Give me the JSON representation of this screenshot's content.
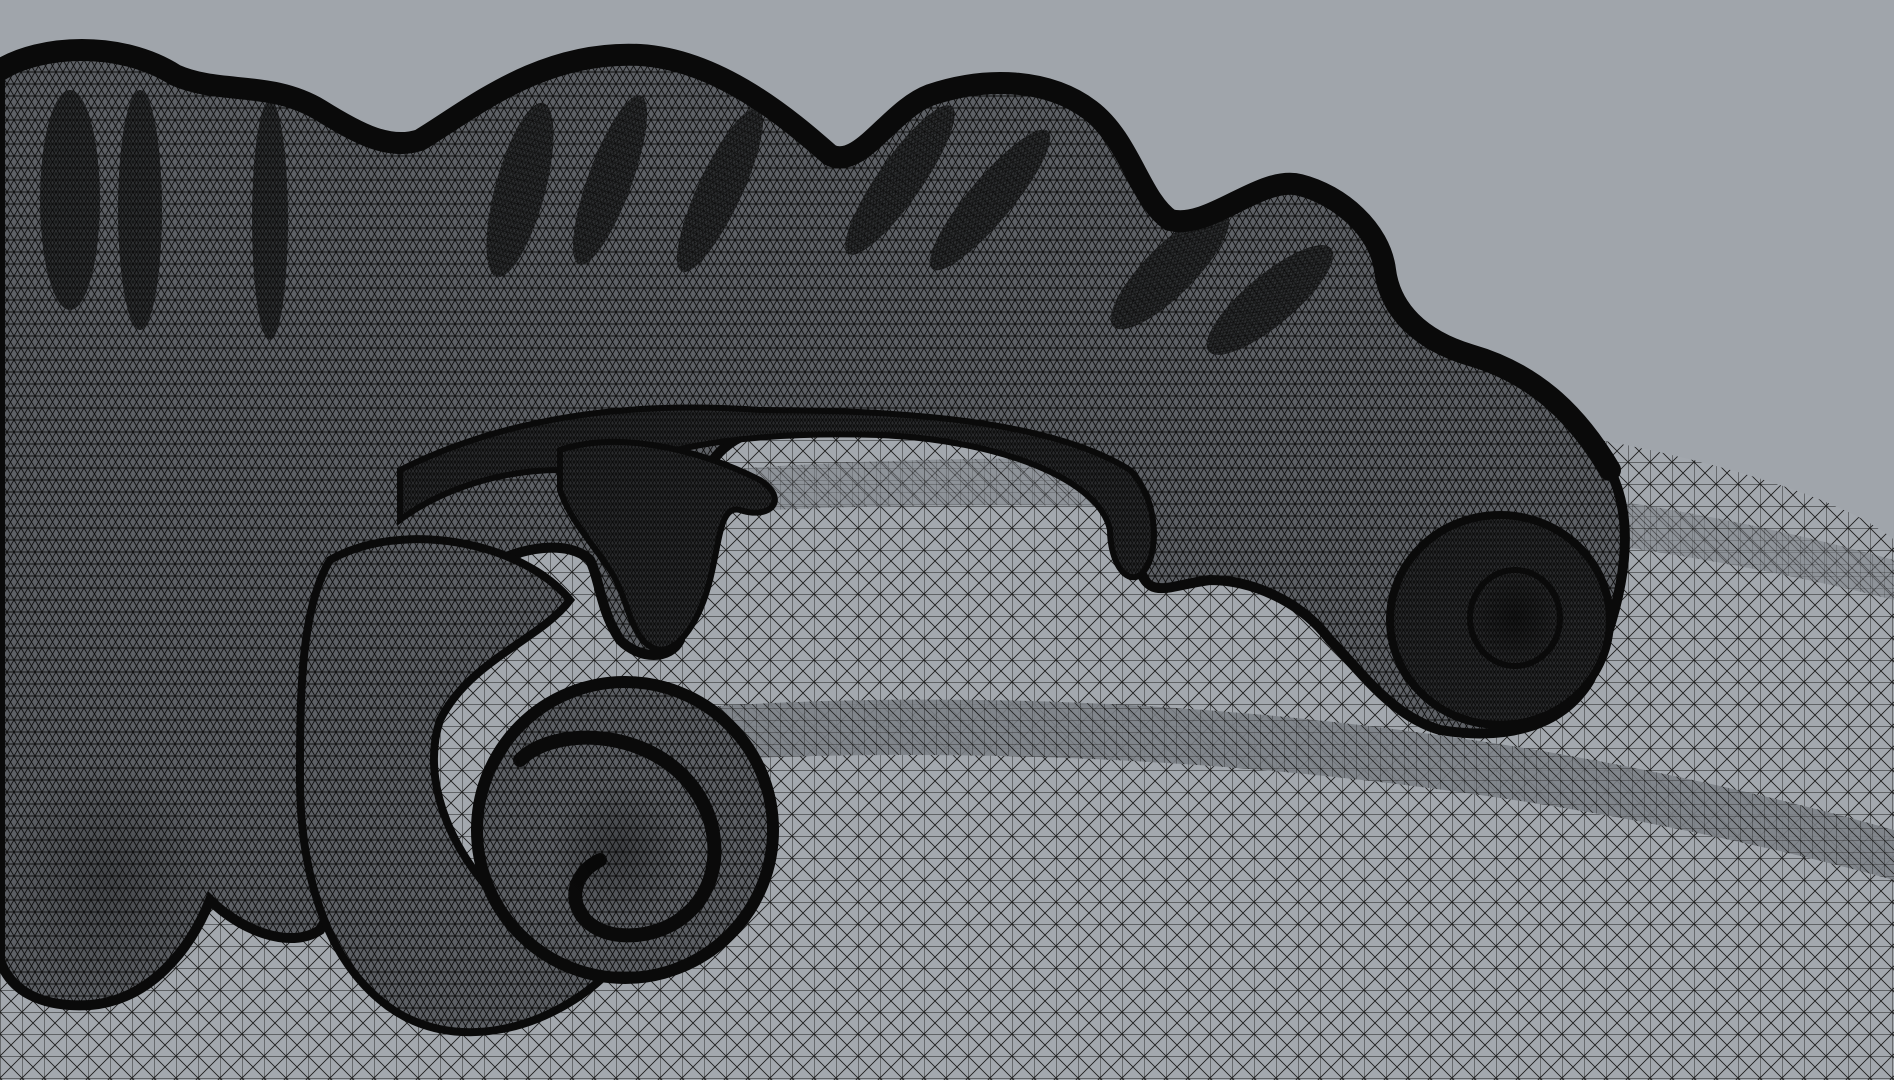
{
  "viewport": {
    "kind": "3d-wireframe-mesh-viewport",
    "mesh_subject": "acanthus-scroll-ornament",
    "render_mode": "wireframe",
    "colors": {
      "background": "#a0a5ab",
      "wire": "#141414",
      "dense_shading": "#1c1c1c",
      "base_mesh": "#9fa4aa"
    }
  }
}
